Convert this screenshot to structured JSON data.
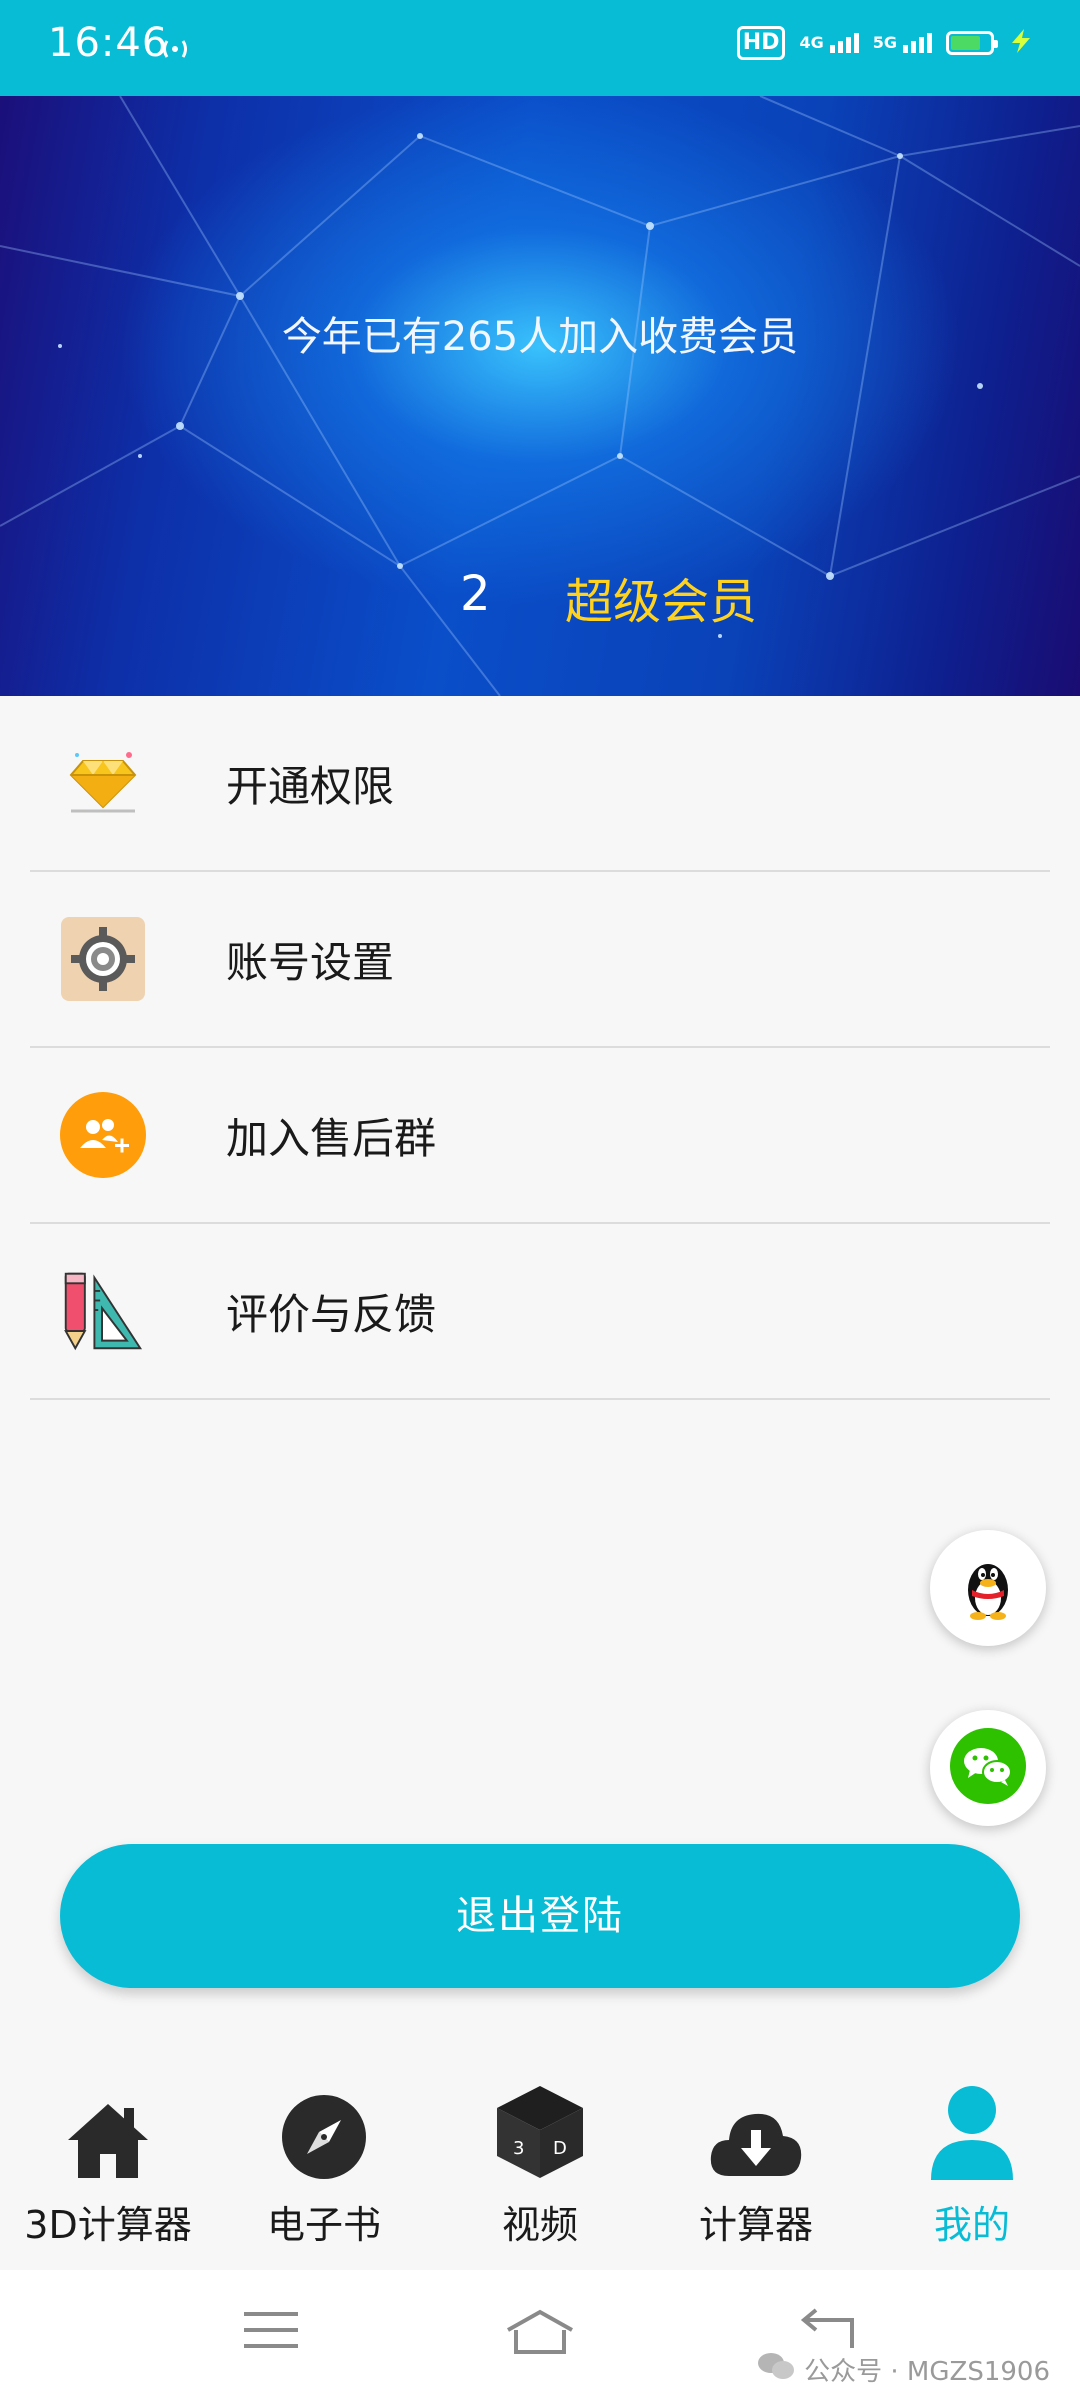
{
  "status_bar": {
    "time": "16:46",
    "hd_label": "HD",
    "network_1": "4G",
    "network_2": "5G",
    "battery_level": 0.75,
    "bg_color": "#08bcd6"
  },
  "banner": {
    "message": "今年已有265人加入收费会员",
    "member_count": "2",
    "member_level": "超级会员",
    "level_color": "#ffd21e"
  },
  "menu": {
    "items": [
      {
        "label": "开通权限",
        "icon": "diamond-icon"
      },
      {
        "label": "账号设置",
        "icon": "gear-icon"
      },
      {
        "label": "加入售后群",
        "icon": "group-add-icon"
      },
      {
        "label": "评价与反馈",
        "icon": "pencil-ruler-icon"
      }
    ]
  },
  "floating": {
    "qq_icon": "qq-penguin-icon",
    "wechat_icon": "wechat-icon"
  },
  "logout": {
    "label": "退出登陆"
  },
  "tabbar": {
    "tabs": [
      {
        "label": "3D计算器",
        "icon": "home-icon"
      },
      {
        "label": "电子书",
        "icon": "compass-icon"
      },
      {
        "label": "视频",
        "icon": "cube-3d-icon"
      },
      {
        "label": "计算器",
        "icon": "cloud-download-icon"
      },
      {
        "label": "我的",
        "icon": "user-icon",
        "active": true
      }
    ],
    "active_color": "#08bcd6"
  },
  "system_nav": {
    "watermark": "公众号 · MGZS1906"
  }
}
